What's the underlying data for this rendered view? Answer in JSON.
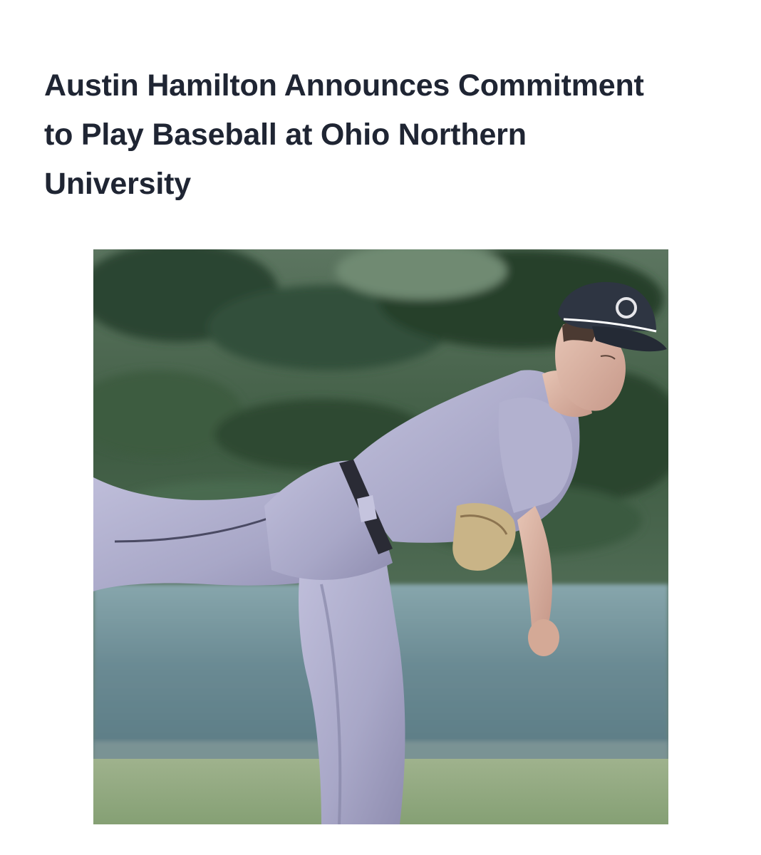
{
  "article": {
    "headline_lines": [
      "Austin Hamilton Announces Commitment",
      "to Play Baseball at Ohio Northern",
      "University"
    ],
    "photo": {
      "subject": "baseball pitcher follow-through",
      "colors": {
        "trees": "#2f4a32",
        "fence": "#6e8e96",
        "grass": "#8fa67d",
        "uniform": "#a9a8c6",
        "cap": "#2e3542",
        "skin": "#d9b2a0"
      }
    }
  }
}
